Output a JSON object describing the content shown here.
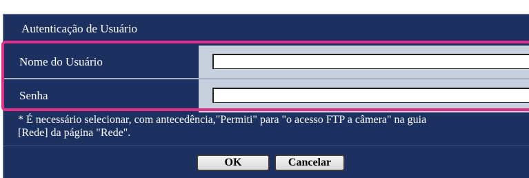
{
  "section": {
    "title": "Autenticação de Usuário"
  },
  "fields": {
    "username": {
      "label": "Nome do Usuário",
      "value": "",
      "placeholder": ""
    },
    "password": {
      "label": "Senha",
      "value": "",
      "placeholder": ""
    }
  },
  "note": {
    "line1": "* É necessário selecionar, com antecedência,\"Permiti\" para \"o acesso FTP a câmera\" na guia",
    "line2": "[Rede] da página \"Rede\"."
  },
  "buttons": {
    "ok_label": "OK",
    "cancel_label": "Cancelar"
  },
  "colors": {
    "panel_background": "#1c3160",
    "input_cell_background": "#c8d0dd",
    "highlight_border": "#e0318a"
  }
}
